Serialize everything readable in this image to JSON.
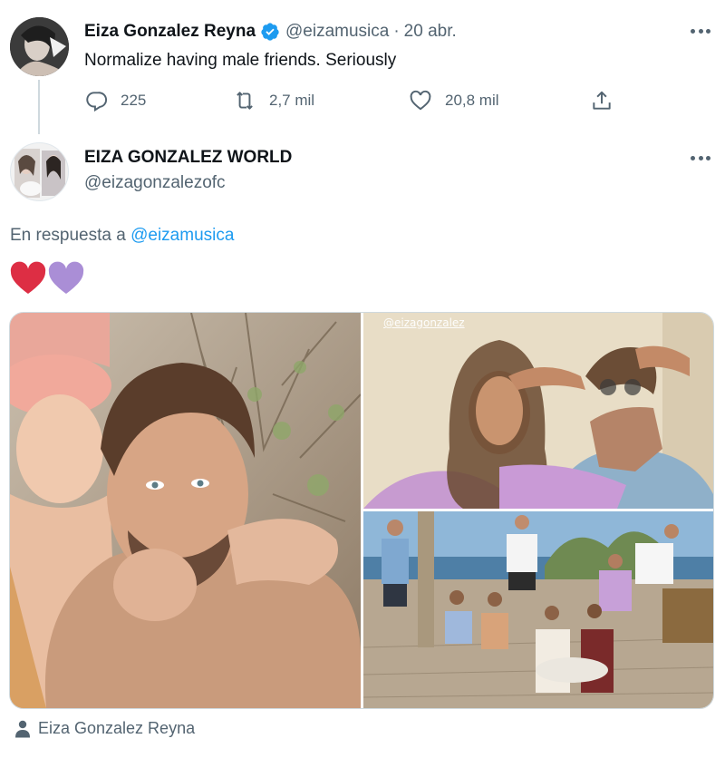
{
  "tweet": {
    "author_name": "Eiza Gonzalez Reyna",
    "author_handle": "@eizamusica",
    "separator": "·",
    "date": "20 abr.",
    "text": "Normalize having male friends. Seriously",
    "actions": {
      "replies": "225",
      "retweets": "2,7 mil",
      "likes": "20,8 mil"
    },
    "icons": [
      "reply-icon",
      "retweet-icon",
      "like-icon",
      "share-icon",
      "verified-badge-icon",
      "more-icon"
    ]
  },
  "reply": {
    "author_name": "EIZA GONZALEZ WORLD",
    "author_handle": "@eizagonzalezofc",
    "reply_prefix": "En respuesta a",
    "reply_mention": "@eizamusica",
    "emojis": [
      "red-heart-emoji",
      "purple-heart-emoji"
    ],
    "media": {
      "photos": 3,
      "watermark": "@eizagonzalez"
    },
    "tagged_user": "Eiza Gonzalez Reyna"
  },
  "colors": {
    "text_primary": "#0f1419",
    "text_secondary": "#536471",
    "link": "#1d9bf0",
    "verified": "#1d9bf0",
    "border": "#cfd9de"
  }
}
